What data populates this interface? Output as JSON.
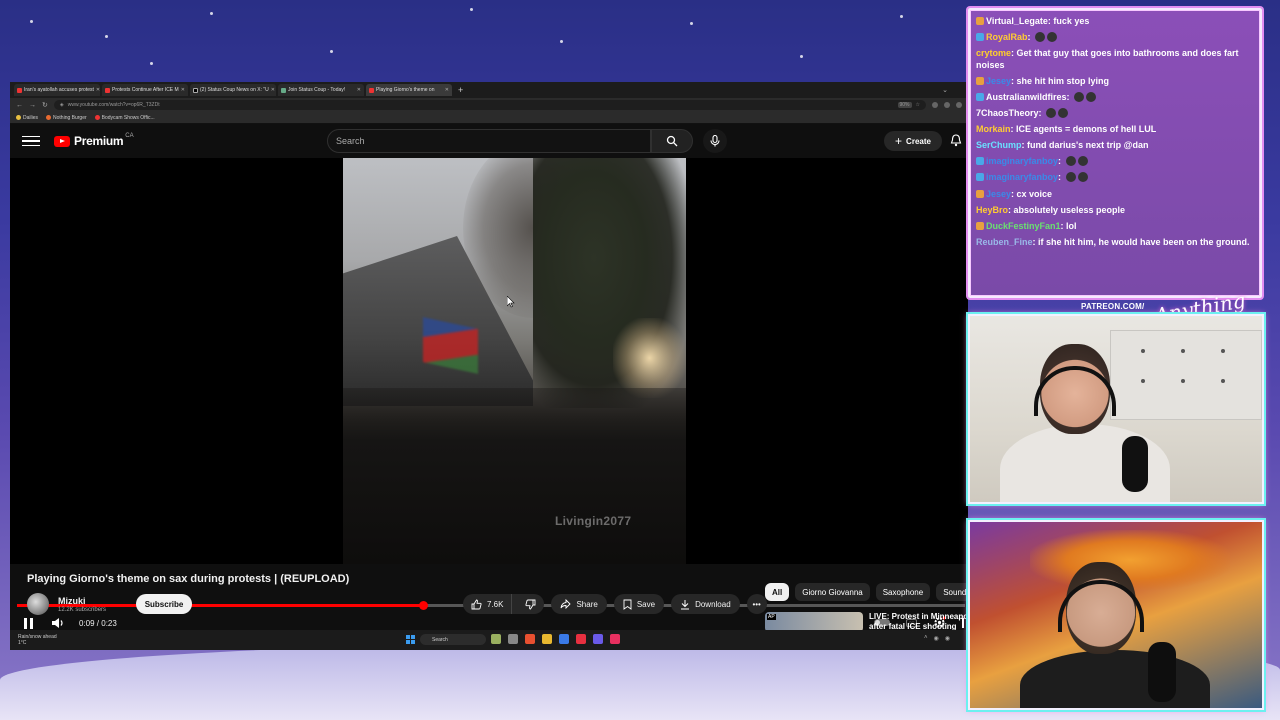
{
  "browser": {
    "tabs": [
      {
        "label": "Iran's ayatollah accuses protest",
        "icon": "youtube-favicon"
      },
      {
        "label": "Protests Continue After ICE M",
        "icon": "youtube-favicon"
      },
      {
        "label": "(2) Status Coup News on X: \"U",
        "icon": "x-favicon"
      },
      {
        "label": "Join Status Coup - Today!",
        "icon": "globe-favicon"
      },
      {
        "label": "Playing Giorno's theme on",
        "icon": "youtube-favicon",
        "active": true
      }
    ],
    "new_tab": "+",
    "url": "www.youtube.com/watch?v=op6R_T3ZDt",
    "zoom": "90%",
    "bookmarks": [
      "Dailies",
      "Nothing Burger",
      "Bodycam Shows Offic..."
    ]
  },
  "youtube": {
    "logo": "Premium",
    "region": "CA",
    "search_placeholder": "Search",
    "create_label": "Create"
  },
  "player": {
    "watermark": "Livingin2077",
    "current_time": "0:09",
    "duration": "0:23",
    "time_display": "0:09 / 0:23",
    "progress": 0.428
  },
  "video": {
    "title": "Playing Giorno's theme on sax during protests | (REUPLOAD)",
    "channel": "Mizuki",
    "subscribers": "12.2K subscribers",
    "subscribe_label": "Subscribe",
    "likes": "7.6K",
    "share_label": "Share",
    "save_label": "Save",
    "download_label": "Download"
  },
  "chips": [
    "All",
    "Giorno Giovanna",
    "Saxophone",
    "Sound"
  ],
  "recommended": {
    "title_line1": "LIVE: Protest in Minneapo",
    "title_line2": "after fatal ICE shooting",
    "thumb_badge": "AP"
  },
  "taskbar": {
    "weather_line1": "Rain/snow ahead",
    "weather_line2": "1°C",
    "search": "Search"
  },
  "chat": [
    {
      "user": "Virtual_Legate",
      "color": "#ffffff",
      "badge": "#e8a040",
      "text": "fuck yes"
    },
    {
      "user": "RoyalRab",
      "color": "#ffcc33",
      "badge": "#4aa8e8",
      "text": ""
    },
    {
      "user": "crytome",
      "color": "#ffd02a",
      "badge": "",
      "text": "Get that guy that goes into bathrooms and does fart noises"
    },
    {
      "user": "Jesey",
      "color": "#3a8ae8",
      "badge": "#e8a040",
      "text": "she hit him stop lying"
    },
    {
      "user": "Australianwildfires",
      "color": "#ffffff",
      "badge": "#4aa8e8",
      "text": ""
    },
    {
      "user": "7ChaosTheory",
      "color": "#ffffff",
      "badge": "",
      "text": ""
    },
    {
      "user": "Morkain",
      "color": "#ffcc33",
      "badge": "",
      "text": "ICE agents = demons of hell LUL"
    },
    {
      "user": "SerChump",
      "color": "#6ae0ff",
      "badge": "",
      "text": "fund darius's next trip @dan"
    },
    {
      "user": "imaginaryfanboy",
      "color": "#3a8ae8",
      "badge": "#4aa8e8",
      "text": ""
    },
    {
      "user": "imaginaryfanboy",
      "color": "#3a8ae8",
      "badge": "#4aa8e8",
      "text": ""
    },
    {
      "user": "Jesey",
      "color": "#3a8ae8",
      "badge": "#e8a040",
      "text": "cx voice"
    },
    {
      "user": "HeyBro",
      "color": "#ffcc33",
      "badge": "",
      "text": "absolutely useless people"
    },
    {
      "user": "DuckFestinyFan1",
      "color": "#6ae070",
      "badge": "#e8a040",
      "text": "lol"
    },
    {
      "user": "Reuben_Fine",
      "color": "#9ab8e8",
      "badge": "",
      "text": "if she hit him, he would have been on the ground."
    }
  ],
  "overlay": {
    "patreon": "PATREON.COM/",
    "signature": "Anything Else"
  },
  "colors": {
    "youtube_red": "#ff0000",
    "chat_bg": "#7a4aa8",
    "cam_glow": "#6cf0f0"
  }
}
